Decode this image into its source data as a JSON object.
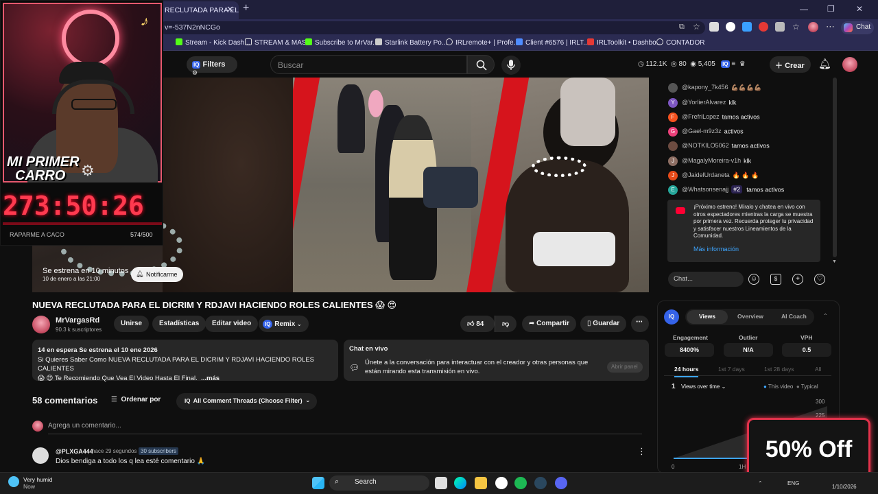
{
  "browser": {
    "tab_title": "RECLUTADA PARA EL DICRI",
    "url": "v=-537N2nNCGo",
    "chat_button": "Chat",
    "bookmarks": [
      "Stream - Kick Dash...",
      "STREAM & MAS",
      "Subscribe to MrVar...",
      "Starlink Battery Po...",
      "IRLremote+ | Profe...",
      "Client #6576 | IRLT...",
      "IRLToolkit • Dashbo...",
      "CONTADOR"
    ]
  },
  "ytbar": {
    "filters_label": "Filters",
    "search_placeholder": "Buscar",
    "stat_views": "112.1K",
    "stat_likes": "80",
    "stat_subs": "5,405",
    "create_label": "Crear"
  },
  "overlay": {
    "banner_line1": "MI PRIMER",
    "banner_line2": "CARRO",
    "timer": "273:50:26",
    "goal_label": "RAPARME A CACO",
    "goal_count": "574/500"
  },
  "video": {
    "premiere_text": "Se estrena en 10 minutos",
    "premiere_date": "10 de enero a las 21:00",
    "notify_label": "Notificarme",
    "title": "NUEVA RECLUTADA PARA EL DICRIM Y RDJAVI HACIENDO ROLES CALIENTES 😱 😍"
  },
  "channel": {
    "name": "MrVargasRd",
    "subs": "90.3 k suscriptores",
    "join": "Unirse",
    "stats": "Estadísticas",
    "edit": "Editar video",
    "remix": "Remix",
    "likes": "84",
    "share": "Compartir",
    "save": "Guardar"
  },
  "description": {
    "line1": "14 en espera  Se estrena el 10 ene 2026",
    "line2": "Si Quieres Saber Como NUEVA RECLUTADA PARA EL DICRIM Y RDJAVI HACIENDO ROLES CALIENTES",
    "line3": "😱 😍 Te Recomiendo Que Vea El Video Hasta El Final.",
    "more": "...más"
  },
  "chat_info": {
    "title": "Chat en vivo",
    "text": "Únete a la conversación para interactuar con el creador y otras personas que están mirando esta transmisión en vivo.",
    "open_label": "Abrir panel"
  },
  "comments": {
    "count_label": "58 comentarios",
    "order_label": "Ordenar por",
    "filter_label": "All Comment Threads (Choose Filter)",
    "add_placeholder": "Agrega un comentario...",
    "first": {
      "author": "@PLXGA444",
      "time": "hace 29 segundos",
      "badge": "30 subscribers",
      "text": "Dios bendiga a todo los q lea esté comentario 🙏"
    }
  },
  "live_chat": {
    "messages": [
      {
        "initial": "",
        "author": "@kapony_7k456",
        "text": "💪🏽💪🏽💪🏽💪🏽",
        "color": "#555555"
      },
      {
        "initial": "Y",
        "author": "@YorlierAlvarez",
        "text": "klk",
        "color": "#7e57c2"
      },
      {
        "initial": "F",
        "author": "@FrefriLopez",
        "text": "tamos activos",
        "color": "#f4511e"
      },
      {
        "initial": "G",
        "author": "@Gael-m9z3z",
        "text": "activos",
        "color": "#ec407a"
      },
      {
        "initial": "",
        "author": "@NOTKILO5062",
        "text": "tamos activos",
        "color": "#6d4c41"
      },
      {
        "initial": "J",
        "author": "@MagalyMoreira-v1h",
        "text": "klk",
        "color": "#8d6e63"
      },
      {
        "initial": "J",
        "author": "@JaidelUrdaneta",
        "text": "🔥 🔥 🔥",
        "color": "#e64a19"
      },
      {
        "initial": "E",
        "author": "@Whatsonsenajj",
        "text": "tamos activos",
        "color": "#26a69a"
      }
    ],
    "rank_badge": "#2",
    "notice": "¡Próximo estreno! Míralo y chatea en vivo con otros espectadores mientras la carga se muestra por primera vez. Recuerda proteger tu privacidad y satisfacer nuestros Lineamientos de la Comunidad.",
    "more_info": "Más información",
    "input_placeholder": "Chat..."
  },
  "analytics": {
    "tabs": [
      "Views",
      "Overview",
      "AI Coach"
    ],
    "metrics": [
      {
        "label": "Engagement",
        "value": "8400%"
      },
      {
        "label": "Outlier",
        "value": "N/A"
      },
      {
        "label": "VPH",
        "value": "0.5"
      }
    ],
    "ranges": [
      "24 hours",
      "1st 7 days",
      "1st 28 days",
      "All"
    ],
    "chart_index": "1",
    "chart_select": "Views over time",
    "legend_this": "This video",
    "legend_typical": "Typical",
    "y_ticks": [
      "300",
      "225"
    ],
    "x_ticks": [
      "0",
      "1H"
    ],
    "accent": "#3ea6ff"
  },
  "promo": "50% Off",
  "taskbar": {
    "weather_title": "Very humid",
    "weather_sub": "Now",
    "search": "Search",
    "lang": "ENG",
    "date": "1/10/2026"
  }
}
